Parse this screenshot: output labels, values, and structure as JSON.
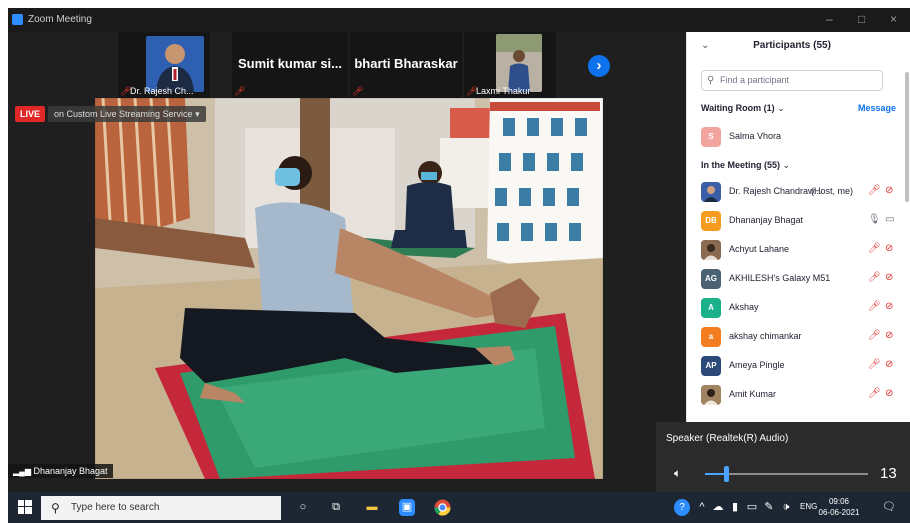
{
  "window": {
    "title": "Zoom Meeting",
    "controls": [
      "–",
      "□",
      "×"
    ]
  },
  "gallery": {
    "thumbnails": [
      {
        "name": "Dr. Rajesh Ch...",
        "muted": true,
        "has_video": true
      },
      {
        "name": "Sumit kumar si...",
        "muted": true,
        "has_video": false
      },
      {
        "name": "bharti Bharaskar",
        "muted": true,
        "has_video": false
      },
      {
        "name": "Laxmi Thakur",
        "muted": true,
        "has_video": true
      }
    ],
    "next_icon": "chevron-right-icon"
  },
  "live": {
    "badge": "LIVE",
    "text": "on Custom Live Streaming Service",
    "chevron": "▾"
  },
  "main_video": {
    "speaker_name": "Dhananjay Bhagat"
  },
  "participants_panel": {
    "title": "Participants (55)",
    "collapse_icon": "chevron-down-icon",
    "search_placeholder": "Find a participant",
    "waiting_room": {
      "label": "Waiting Room (1)",
      "message_label": "Message",
      "people": [
        {
          "initial": "S",
          "name": "Salma Vhora",
          "color": "#f2a49e"
        }
      ]
    },
    "in_meeting": {
      "label": "In the Meeting (55)",
      "people": [
        {
          "initial": "",
          "name": "Dr. Rajesh Chandraw...",
          "role": "(Host, me)",
          "color": "#3a5fa8",
          "photo": true,
          "mic": "muted",
          "video": "off"
        },
        {
          "initial": "DB",
          "name": "Dhananjay Bhagat",
          "role": "",
          "color": "#f59b1f",
          "photo": false,
          "mic": "on",
          "video": "off-grey"
        },
        {
          "initial": "",
          "name": "Achyut Lahane",
          "role": "",
          "color": "#7a5c48",
          "photo": true,
          "mic": "muted",
          "video": "off"
        },
        {
          "initial": "AG",
          "name": "AKHILESH's Galaxy M51",
          "role": "",
          "color": "#4a6272",
          "photo": false,
          "mic": "muted",
          "video": "off"
        },
        {
          "initial": "A",
          "name": "Akshay",
          "role": "",
          "color": "#19b08a",
          "photo": false,
          "mic": "muted",
          "video": "off"
        },
        {
          "initial": "a",
          "name": "akshay chimankar",
          "role": "",
          "color": "#f27d20",
          "photo": false,
          "mic": "muted",
          "video": "off"
        },
        {
          "initial": "AP",
          "name": "Ameya Pingle",
          "role": "",
          "color": "#2b4a7a",
          "photo": false,
          "mic": "muted",
          "video": "off"
        },
        {
          "initial": "",
          "name": "Amit Kumar",
          "role": "",
          "color": "#8a6d4a",
          "photo": true,
          "mic": "muted",
          "video": "off"
        }
      ]
    }
  },
  "volume_flyout": {
    "device": "Speaker (Realtek(R) Audio)",
    "level": 13,
    "level_fraction": 0.13
  },
  "taskbar": {
    "search_placeholder": "Type here to search",
    "language": "ENG",
    "time": "09:06",
    "date": "06-06-2021"
  },
  "colors": {
    "zoom_blue": "#0e72ed",
    "live_red": "#e02828",
    "muted_red": "#e02828"
  }
}
